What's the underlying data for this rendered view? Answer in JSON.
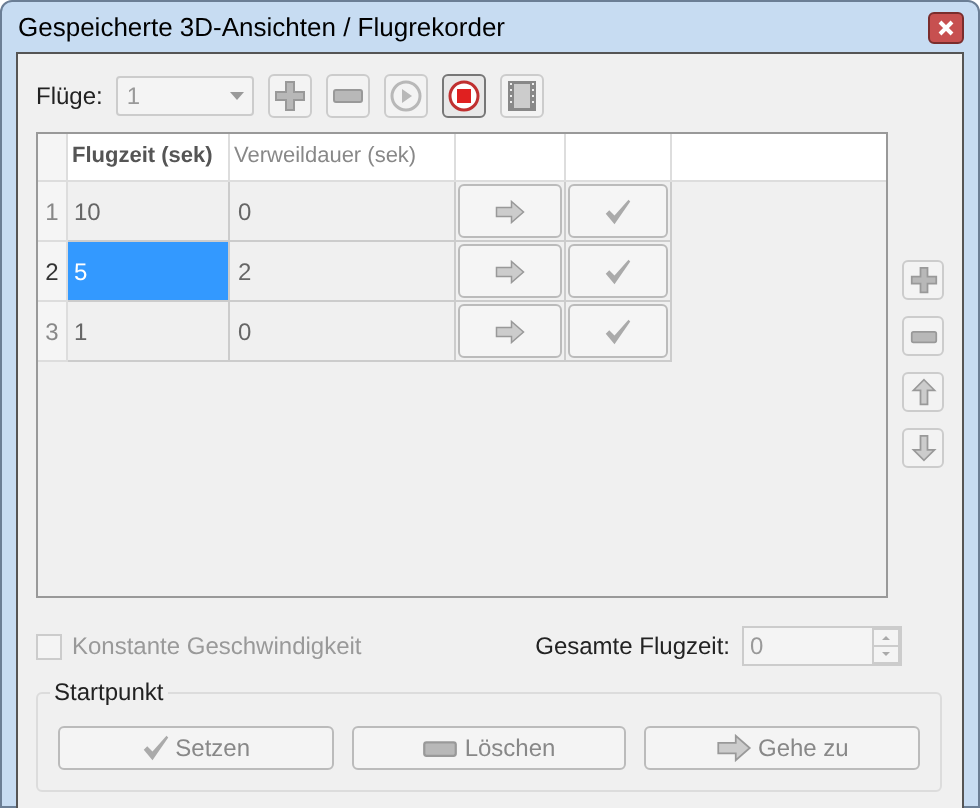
{
  "window": {
    "title": "Gespeicherte 3D-Ansichten / Flugrekorder"
  },
  "toolbar": {
    "label": "Flüge:",
    "combo": {
      "value": "1",
      "disabled": true
    },
    "buttons": [
      {
        "kind": "add",
        "disabled": true
      },
      {
        "kind": "remove",
        "disabled": true
      },
      {
        "kind": "play",
        "disabled": true
      },
      {
        "kind": "stop",
        "disabled": false
      },
      {
        "kind": "film",
        "disabled": true
      }
    ]
  },
  "table": {
    "columns": [
      {
        "label": "Flugzeit (sek)",
        "selected": true
      },
      {
        "label": "Verweildauer (sek)",
        "selected": false
      }
    ],
    "rows": [
      {
        "number": "1",
        "flight_time": "10",
        "dwell": "0",
        "selected": false
      },
      {
        "number": "2",
        "flight_time": "5",
        "dwell": "2",
        "selected": true
      },
      {
        "number": "3",
        "flight_time": "1",
        "dwell": "0",
        "selected": false
      }
    ]
  },
  "side_buttons": [
    {
      "kind": "add",
      "disabled": true
    },
    {
      "kind": "remove",
      "disabled": true
    },
    {
      "kind": "up",
      "disabled": true
    },
    {
      "kind": "down",
      "disabled": true
    }
  ],
  "constant_speed": {
    "label": "Konstante Geschwindigkeit",
    "checked": false,
    "disabled": true
  },
  "total_time": {
    "label": "Gesamte Flugzeit:",
    "value": "0",
    "disabled": true
  },
  "start_point": {
    "title": "Startpunkt",
    "buttons": [
      {
        "label": "Setzen",
        "kind": "check",
        "disabled": true
      },
      {
        "label": "Löschen",
        "kind": "remove",
        "disabled": true
      },
      {
        "label": "Gehe zu",
        "kind": "arrow",
        "disabled": true
      }
    ]
  }
}
